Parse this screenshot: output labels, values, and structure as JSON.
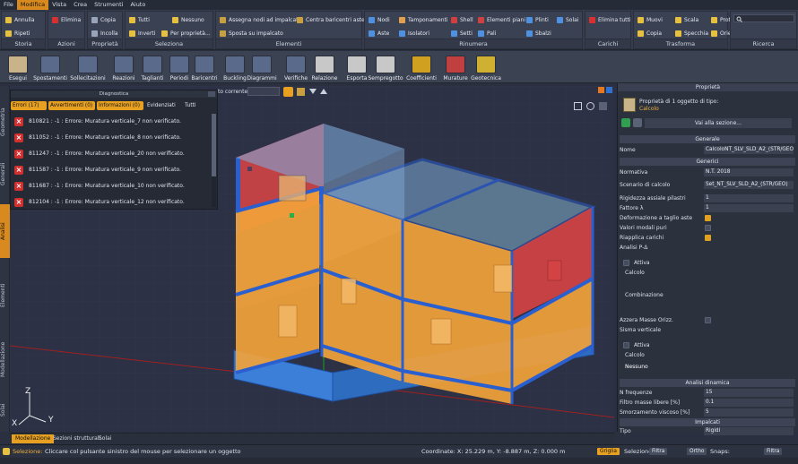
{
  "menu": [
    "File",
    "Modifica",
    "Vista",
    "Crea",
    "Strumenti",
    "Aiuto"
  ],
  "ribbon": {
    "groups": [
      {
        "label": "Storia",
        "buttons": [
          "Annulla",
          "Ripeti"
        ]
      },
      {
        "label": "Azioni",
        "buttons": [
          "Elimina"
        ]
      },
      {
        "label": "Proprietà",
        "buttons": [
          "Copia",
          "Incolla"
        ]
      },
      {
        "label": "Seleziona",
        "buttons": [
          "Tutti",
          "Nessuno",
          "Inverti",
          "Per proprietà..."
        ]
      },
      {
        "label": "Elementi",
        "buttons": [
          "Assegna nodi ad impalcati",
          "Centra baricentri aste",
          "Sposta su impalcato"
        ]
      },
      {
        "label": "Rinumera",
        "buttons": [
          "Nodi",
          "Tamponamenti",
          "Shell",
          "Elementi piani",
          "Plinti",
          "Solai",
          "Aste",
          "Isolatori",
          "Setti",
          "Pali",
          "Sbalzi"
        ]
      },
      {
        "label": "Carichi",
        "buttons": [
          "Elimina tutti"
        ]
      },
      {
        "label": "Trasforma",
        "buttons": [
          "Muovi",
          "Scala",
          "Prot",
          "Copia",
          "Specchia",
          "Orie"
        ]
      },
      {
        "label": "Ricerca",
        "buttons": []
      }
    ]
  },
  "toolbar": [
    "Esegui",
    "Spostamenti",
    "Sollecitazioni",
    "Reazioni",
    "Taglianti",
    "Periodi",
    "Baricentri",
    "Buckling",
    "Diagrammi",
    "Verifiche",
    "Relazione",
    "Esporta",
    "Sempregotto",
    "Coefficienti",
    "Murature",
    "Geotecnica"
  ],
  "left_tabs": [
    "Geometria",
    "Generali",
    "Analisi",
    "Elementi",
    "Modellazione",
    "Solai"
  ],
  "diagnostics": {
    "title": "Diagnostica",
    "tabs": {
      "errors": "Errori (17)",
      "warnings": "Avvertimenti (0)",
      "info": "Informazioni (0)",
      "highlight": "Evidenziati",
      "all": "Tutti"
    },
    "rows": [
      "810821 : -1 : Errore: Muratura verticale_7 non verificato.",
      "811052 : -1 : Errore: Muratura verticale_8 non verificato.",
      "811247 : -1 : Errore: Muratura verticale_20 non verificato.",
      "811587 : -1 : Errore: Muratura verticale_9 non verificato.",
      "811687 : -1 : Errore: Muratura verticale_10 non verificato.",
      "812104 : -1 : Errore: Muratura verticale_12 non verificato."
    ]
  },
  "viewport": {
    "level_label": "to corrente:",
    "axis_z": "Z",
    "axis_y": "Y",
    "axis_x": "X"
  },
  "properties": {
    "title": "Proprietà",
    "header": "Proprietà di 1 oggetto di tipo:",
    "type": "Calcolo",
    "goto": "Vai alla sezione...",
    "sec_general": "Generale",
    "name_label": "Nome",
    "name_value": "CalcoloNT_SLV_SLD_A2_(STR/GEO)",
    "sec_generic": "Generici",
    "norm_label": "Normativa",
    "norm_value": "N.T. 2018",
    "scen_label": "Scenario di calcolo",
    "scen_value": "Set_NT_SLV_SLD_A2_(STR/GEO)",
    "rig_label": "Rigidezza assiale pilastri",
    "rig_value": "1",
    "fat_label": "Fattore λ",
    "fat_value": "1",
    "def_label": "Deformazione a taglio aste",
    "val_label": "Valori modali puri",
    "rip_label": "Riapplica carichi",
    "anp_label": "Analisi P-Δ",
    "attiva1": "Attiva",
    "calcolo1": "Calcolo",
    "comb": "Combinazione",
    "azz_label": "Azzera Masse Orizz.",
    "sis_label": "Sisma verticale",
    "attiva2": "Attiva",
    "calcolo2": "Calcolo",
    "nessuno": "Nessuno",
    "sec_dyn": "Analisi dinamica",
    "freq_label": "N frequenze",
    "freq_value": "15",
    "filt_label": "Filtro masse libere [%]",
    "filt_value": "0.1",
    "smorz_label": "Smorzamento viscoso [%]",
    "smorz_value": "5",
    "sec_imp": "Impalcati",
    "tipo_label": "Tipo",
    "tipo_value": "Rigidi"
  },
  "bottom_tabs": [
    "Modellazione",
    "Sezioni strutturali",
    "Solai"
  ],
  "status": {
    "selection": "Selezione:",
    "hint": "Cliccare col pulsante sinistro del mouse per selezionare un oggetto",
    "coords": "Coordinate: X: 25.229 m, Y: -8.887 m, Z: 0.000 m",
    "griglia": "Griglia",
    "selezione": "Selezione:",
    "filtra": "Filtra",
    "ortho": "Ortho",
    "snaps": "Snaps:",
    "filtra2": "Filtra"
  }
}
